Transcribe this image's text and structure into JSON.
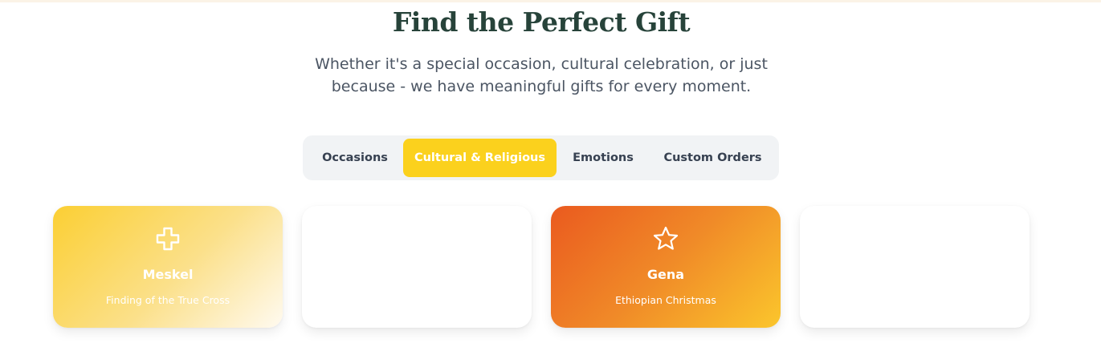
{
  "header": {
    "title": "Find the Perfect Gift",
    "subtitle": "Whether it's a special occasion, cultural celebration, or just because - we have meaningful gifts for every moment."
  },
  "tabs": [
    {
      "label": "Occasions",
      "active": false
    },
    {
      "label": "Cultural & Religious",
      "active": true
    },
    {
      "label": "Emotions",
      "active": false
    },
    {
      "label": "Custom Orders",
      "active": false
    }
  ],
  "cards": [
    {
      "title": "Meskel",
      "subtitle": "Finding of the True Cross",
      "icon": "cross-icon"
    },
    {
      "title": "",
      "subtitle": "",
      "icon": ""
    },
    {
      "title": "Gena",
      "subtitle": "Ethiopian Christmas",
      "icon": "star-icon"
    },
    {
      "title": "",
      "subtitle": "",
      "icon": ""
    }
  ],
  "colors": {
    "title": "#27433a",
    "accent": "#fbd11d",
    "tab_bar_bg": "#f1f3f5",
    "meskel_gradient_start": "#fbcf33",
    "gena_gradient_start": "#ea5a1f",
    "gena_gradient_end": "#fbc62c"
  }
}
